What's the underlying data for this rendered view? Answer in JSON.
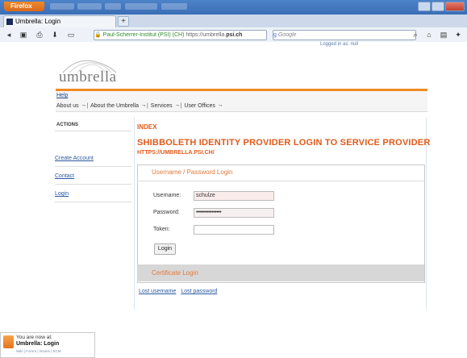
{
  "browser": {
    "app_button": "Firefox",
    "tab_title": "Umbrella: Login",
    "new_tab": "+",
    "url_site": "Paul-Scherrer-Institut (PSI) (CH)",
    "url_prefix": "https://umbrella.",
    "url_domain": "psi.ch",
    "search_placeholder": "Google",
    "icons": [
      "back-arrow-icon",
      "home-icon",
      "print-icon",
      "download-icon",
      "window-icon",
      "lock-icon",
      "star-icon",
      "refresh-icon",
      "search-icon",
      "home-icon",
      "menu-icon"
    ]
  },
  "header": {
    "logged_in": "Logged in as: null",
    "logo_text": "umbrella",
    "help": "Help",
    "menu": [
      "About us",
      "About the Umbrella",
      "Services",
      "User Offices"
    ]
  },
  "sidebar": {
    "actions_label": "ACTIONS",
    "links": [
      "Create Account",
      "Contact",
      "Login"
    ]
  },
  "main": {
    "index": "INDEX",
    "title": "SHIBBOLETH IDENTITY PROVIDER LOGIN TO SERVICE PROVIDER",
    "subtitle": "HTTPS://UMBRELLA.PSI.CH/",
    "login_section": "Username / Password Login",
    "username_label": "Username:",
    "username_value": "schulze",
    "password_label": "Password:",
    "password_value": "••••••••••••••••",
    "token_label": "Token:",
    "token_value": "",
    "login_button": "Login",
    "cert_section": "Certificate Login",
    "lost_username": "Lost username",
    "lost_password": "Lost password"
  },
  "notification": {
    "line1": "You are now at:",
    "line2": "Umbrella: Login",
    "line3": "Wiki | Forum | Issues | SCM"
  }
}
